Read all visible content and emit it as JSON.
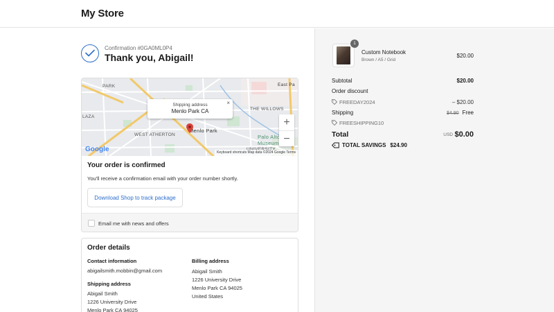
{
  "header": {
    "store_name": "My Store"
  },
  "confirmation": {
    "number_label": "Confirmation #0GA0ML0P4",
    "thanks": "Thank you, Abigail!"
  },
  "map": {
    "popup_title": "Shipping address",
    "popup_city": "Menlo Park CA",
    "labels": {
      "park": "PARK",
      "east_pa": "East Pa",
      "the_willows": "THE WILLOWS",
      "west_atherton": "WEST ATHERTON",
      "menlo_park": "Menlo Park",
      "laza": "LAZA",
      "palo_alto": "Palo Alto",
      "museum": "Museum a",
      "university": "UNIVERSITY"
    },
    "google": "Google",
    "attribution": "Keyboard shortcuts   Map data ©2024 Google   Terms",
    "zoom_in": "+",
    "zoom_out": "−",
    "close": "×"
  },
  "order_status": {
    "title": "Your order is confirmed",
    "text": "You'll receive a confirmation email with your order number shortly.",
    "track_button": "Download Shop to track package",
    "newsletter_label": "Email me with news and offers"
  },
  "order_details": {
    "title": "Order details",
    "contact_heading": "Contact information",
    "contact_email": "abigailsmith.mobbin@gmail.com",
    "shipping_heading": "Shipping address",
    "shipping_lines": [
      "Abigail Smith",
      "1226 University Drive",
      "Menlo Park CA 94025"
    ],
    "billing_heading": "Billing address",
    "billing_lines": [
      "Abigail Smith",
      "1226 University Drive",
      "Menlo Park CA 94025",
      "United States"
    ]
  },
  "summary": {
    "item": {
      "quantity": "1",
      "name": "Custom Notebook",
      "variant": "Brown / A5 / Grid",
      "price": "$20.00"
    },
    "subtotal_label": "Subtotal",
    "subtotal_value": "$20.00",
    "discount_label": "Order discount",
    "discount_code": "FREEDAY2024",
    "discount_value": "– $20.00",
    "shipping_label": "Shipping",
    "shipping_old": "$4.90",
    "shipping_value": "Free",
    "shipping_code": "FREESHIPPING10",
    "total_label": "Total",
    "total_currency": "USD",
    "total_value": "$0.00",
    "savings_label": "TOTAL SAVINGS",
    "savings_value": "$24.90"
  },
  "colors": {
    "accent": "#2c6ecb",
    "summary_bg": "#f5f5f5",
    "map_pin": "#d9443a"
  }
}
